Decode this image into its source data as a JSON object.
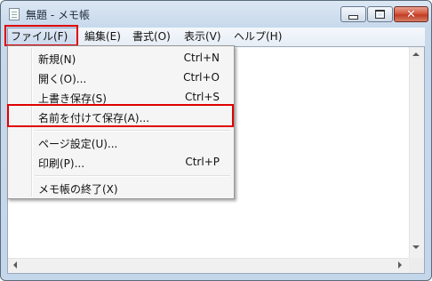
{
  "window": {
    "title": "無題 - メモ帳"
  },
  "titlebar_buttons": {
    "close_glyph": "✕"
  },
  "menubar": {
    "items": [
      {
        "label": "ファイル(F)"
      },
      {
        "label": "編集(E)"
      },
      {
        "label": "書式(O)"
      },
      {
        "label": "表示(V)"
      },
      {
        "label": "ヘルプ(H)"
      }
    ]
  },
  "file_menu": {
    "items": [
      {
        "label": "新規(N)",
        "shortcut": "Ctrl+N"
      },
      {
        "label": "開く(O)...",
        "shortcut": "Ctrl+O"
      },
      {
        "label": "上書き保存(S)",
        "shortcut": "Ctrl+S"
      },
      {
        "label": "名前を付けて保存(A)...",
        "shortcut": ""
      },
      {
        "label": "ページ設定(U)...",
        "shortcut": ""
      },
      {
        "label": "印刷(P)...",
        "shortcut": "Ctrl+P"
      },
      {
        "label": "メモ帳の終了(X)",
        "shortcut": ""
      }
    ]
  },
  "colors": {
    "highlight_box": "#e00000",
    "close_button": "#c23c24"
  }
}
